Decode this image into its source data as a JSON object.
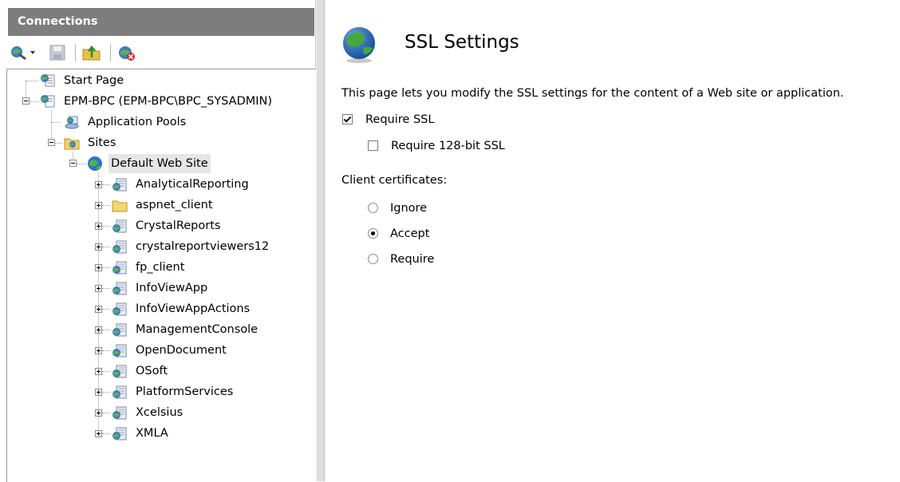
{
  "connections": {
    "title": "Connections",
    "tree": {
      "start_page": "Start Page",
      "server": "EPM-BPC (EPM-BPC\\BPC_SYSADMIN)",
      "app_pools": "Application Pools",
      "sites": "Sites",
      "default_site": "Default Web Site",
      "children": [
        "AnalyticalReporting",
        "aspnet_client",
        "CrystalReports",
        "crystalreportviewers12",
        "fp_client",
        "InfoViewApp",
        "InfoViewAppActions",
        "ManagementConsole",
        "OpenDocument",
        "OSoft",
        "PlatformServices",
        "Xcelsius",
        "XMLA"
      ]
    }
  },
  "ssl": {
    "title": "SSL Settings",
    "description": "This page lets you modify the SSL settings for the content of a Web site or application.",
    "require_ssl": {
      "label": "Require SSL",
      "checked": true
    },
    "require_128": {
      "label": "Require 128-bit SSL",
      "checked": false
    },
    "client_certs_label": "Client certificates:",
    "options": [
      {
        "label": "Ignore",
        "selected": false
      },
      {
        "label": "Accept",
        "selected": true
      },
      {
        "label": "Require",
        "selected": false
      }
    ]
  },
  "colors": {
    "header_bg": "#7d7d7d",
    "selected_bg": "#e6e6e6"
  }
}
